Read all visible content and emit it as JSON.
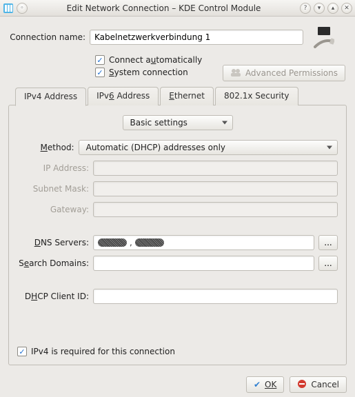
{
  "window": {
    "title": "Edit Network Connection – KDE Control Module"
  },
  "form": {
    "name_label": "Connection name:",
    "name_value": "Kabelnetzwerkverbindung 1",
    "connect_auto": "Connect automatically",
    "system_conn": "System connection",
    "advanced_btn": "Advanced Permissions"
  },
  "tabs": {
    "ipv4": "IPv4 Address",
    "ipv6": "IPv6 Address",
    "ethernet": "Ethernet",
    "dot1x": "802.1x Security"
  },
  "panel": {
    "basic": "Basic settings",
    "method_label": "Method:",
    "method_value": "Automatic (DHCP) addresses only",
    "ip_label": "IP Address:",
    "subnet_label": "Subnet Mask:",
    "gateway_label": "Gateway:",
    "dns_label": "DNS Servers:",
    "search_label": "Search Domains:",
    "dhcp_label": "DHCP Client ID:",
    "dots": "...",
    "required": "IPv4 is required for this connection"
  },
  "footer": {
    "ok": "OK",
    "cancel": "Cancel"
  }
}
